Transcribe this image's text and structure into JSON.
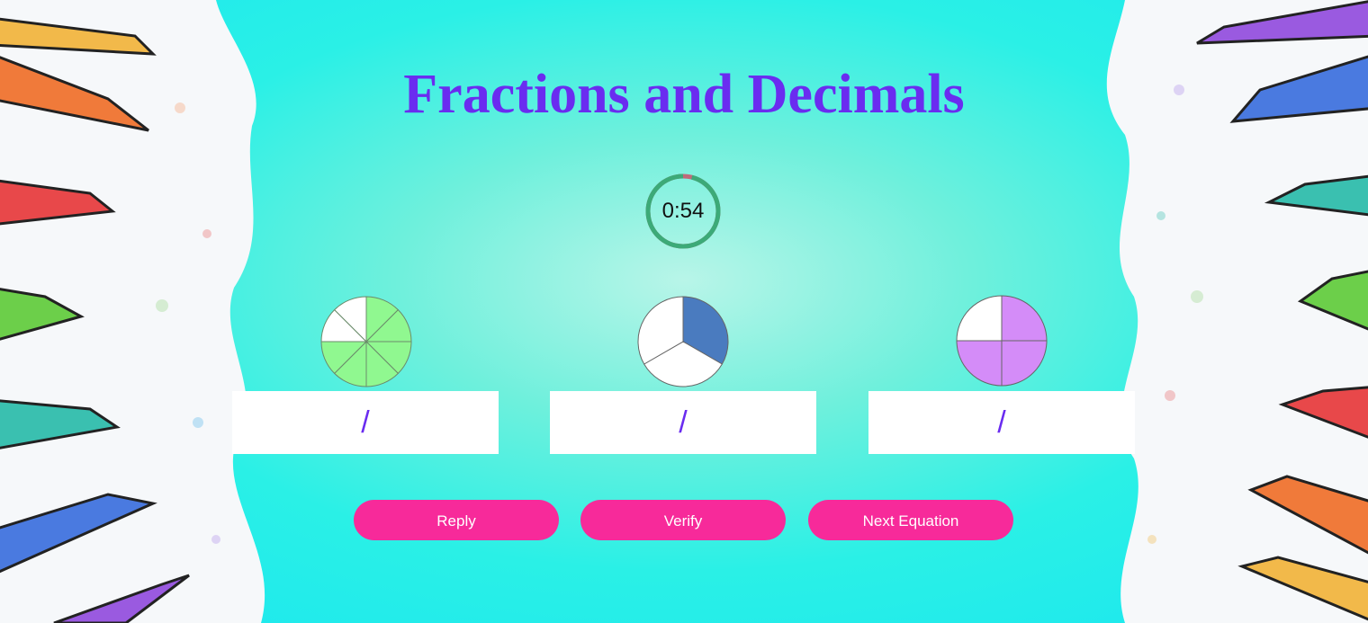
{
  "game": {
    "title": "Fractions and Decimals",
    "timer_text": "0:54",
    "timer_fraction_remaining": 0.96,
    "colors": {
      "title": "#6a2cf0",
      "timer_ring": "#3caa78",
      "timer_elapsed": "#c06a7a",
      "button": "#f72a9a"
    },
    "pies": [
      {
        "slices": 8,
        "filled": 6,
        "color": "#90f890",
        "divider": "#6b8b6b",
        "answer_text": "/"
      },
      {
        "slices": 3,
        "filled": 1,
        "color": "#4a7bbf",
        "divider": "#666666",
        "answer_text": "/"
      },
      {
        "slices": 4,
        "filled": 3,
        "color": "#d48cf8",
        "divider": "#666666",
        "answer_text": "/"
      }
    ],
    "buttons": {
      "reply": "Reply",
      "verify": "Verify",
      "next": "Next Equation"
    }
  }
}
